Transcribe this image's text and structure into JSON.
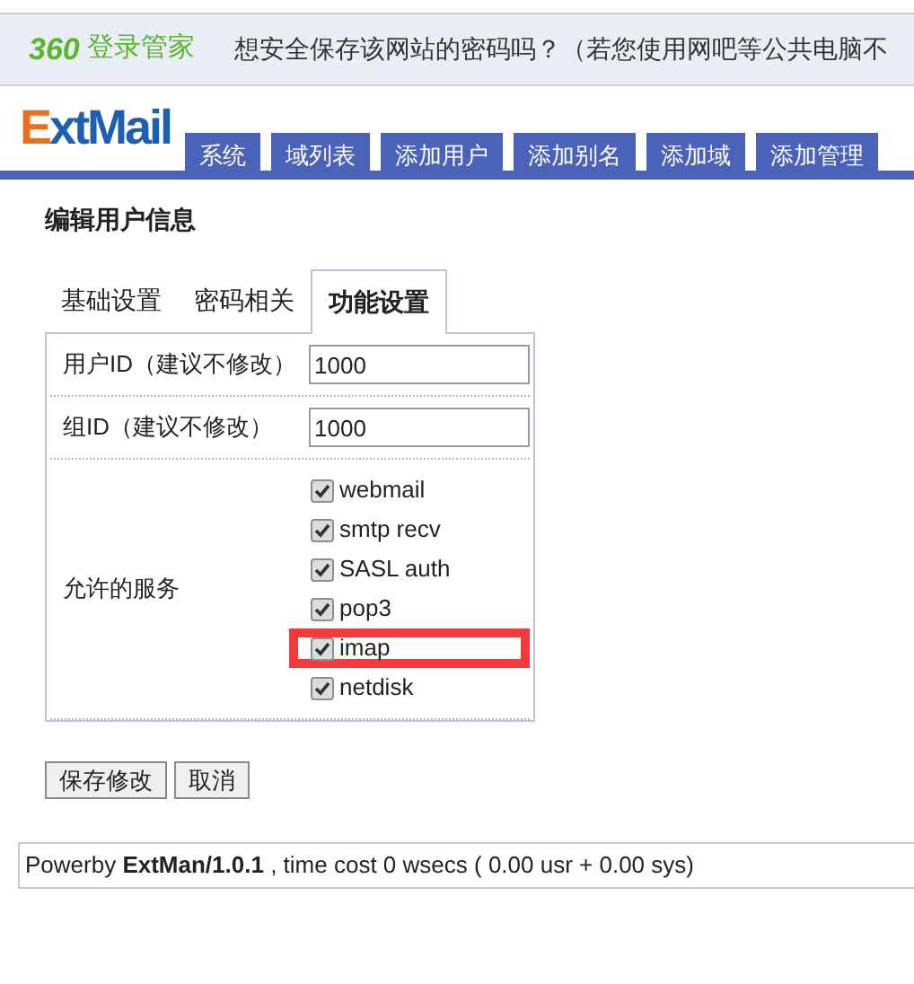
{
  "login_bar": {
    "logo_number": "360",
    "logo_text": "登录管家",
    "message": "想安全保存该网站的密码吗？（若您使用网吧等公共电脑不"
  },
  "header": {
    "logo_first": "E",
    "logo_rest": "xtMail",
    "nav": [
      {
        "label": "系统"
      },
      {
        "label": "域列表"
      },
      {
        "label": "添加用户"
      },
      {
        "label": "添加别名"
      },
      {
        "label": "添加域"
      },
      {
        "label": "添加管理"
      }
    ]
  },
  "page_title": "编辑用户信息",
  "tabs": [
    {
      "label": "基础设置",
      "selected": false
    },
    {
      "label": "密码相关",
      "selected": false
    },
    {
      "label": "功能设置",
      "selected": true
    }
  ],
  "fields": [
    {
      "label": "用户ID（建议不修改）",
      "value": "1000"
    },
    {
      "label": "组ID（建议不修改）",
      "value": "1000"
    }
  ],
  "services": {
    "label": "允许的服务",
    "items": [
      {
        "label": "webmail",
        "checked": true,
        "highlighted": false
      },
      {
        "label": "smtp recv",
        "checked": true,
        "highlighted": false
      },
      {
        "label": "SASL auth",
        "checked": true,
        "highlighted": false
      },
      {
        "label": "pop3",
        "checked": true,
        "highlighted": false
      },
      {
        "label": "imap",
        "checked": true,
        "highlighted": true
      },
      {
        "label": "netdisk",
        "checked": true,
        "highlighted": false
      }
    ]
  },
  "buttons": [
    "保存修改",
    "取消"
  ],
  "footer": "Powerby **ExtMan/1.0.1** , time cost 0 wsecs ( 0.00 usr + 0.00 sys)"
}
